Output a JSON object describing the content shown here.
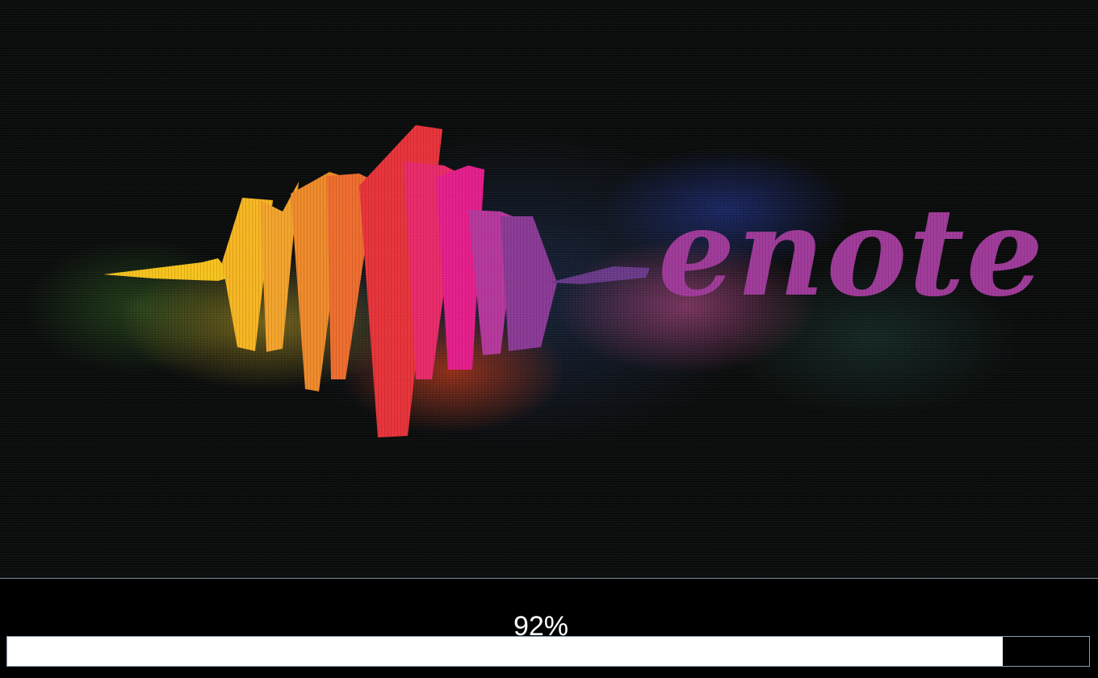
{
  "logo": {
    "text": "enote",
    "colors": {
      "yellow": "#f7c31c",
      "orange": "#f08a2a",
      "red": "#e8333a",
      "pink": "#e61e8c",
      "purple": "#a03a9a",
      "dark_purple": "#6a3a8a"
    }
  },
  "progress": {
    "label": "92%",
    "value": 0.92
  }
}
